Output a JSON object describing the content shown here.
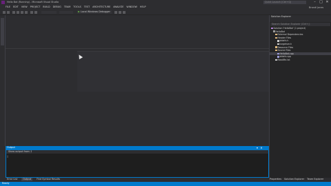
{
  "window": {
    "title": "Hello Bot (Running) - Microsoft Visual Studio",
    "quick_launch_placeholder": "Quick Launch (Ctrl+Q)",
    "user": "Brandi Jones"
  },
  "menu": [
    "FILE",
    "EDIT",
    "VIEW",
    "PROJECT",
    "BUILD",
    "DEBUG",
    "TEAM",
    "TOOLS",
    "TEST",
    "ARCHITECTURE",
    "ANALYZE",
    "WINDOW",
    "HELP"
  ],
  "toolbar": {
    "start_label": "Local Windows Debugger"
  },
  "solution_explorer": {
    "title": "Solution Explorer",
    "search_placeholder": "Search Solution Explorer (Ctrl+;)",
    "items": [
      "Solution 'HelloBot' (1 project)",
      "HelloBot",
      "External Dependencies",
      "Header Files",
      "stdafx.h",
      "targetver.h",
      "Resource Files",
      "Source Files",
      "HelloBot.cpp",
      "stdafx.cpp",
      "ReadMe.txt"
    ],
    "selected_index": 8,
    "tabs": [
      "Properties",
      "Solution Explorer",
      "Team Explorer"
    ]
  },
  "output": {
    "title": "Output",
    "source_label": "Show output from: Debug",
    "text": "|"
  },
  "bottom_tabs": [
    "Error List",
    "Output",
    "Find Symbol Results"
  ],
  "status": {
    "text": "Ready"
  }
}
